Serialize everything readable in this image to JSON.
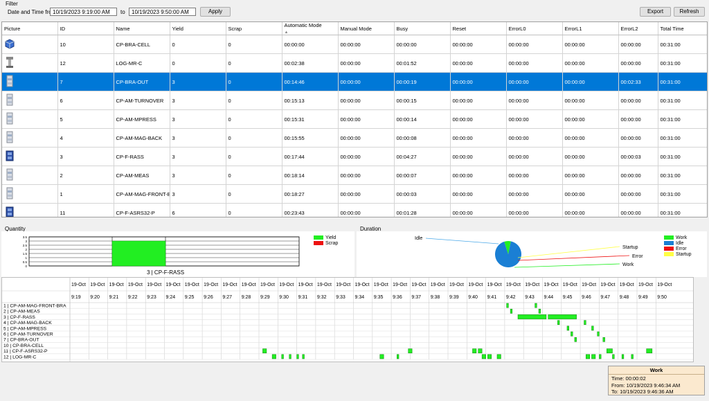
{
  "filter": {
    "title": "Filter",
    "label": "Date and Time from",
    "from": "10/19/2023  9:19:00 AM",
    "to_label": "to",
    "to": "10/19/2023  9:50:00 AM",
    "apply": "Apply",
    "export": "Export",
    "refresh": "Refresh"
  },
  "table": {
    "columns": [
      "Picture",
      "ID",
      "Name",
      "Yield",
      "Scrap",
      "Automatic Mode",
      "Manual Mode",
      "Busy",
      "Reset",
      "ErrorL0",
      "ErrorL1",
      "ErrorL2",
      "Total Time"
    ],
    "rows": [
      {
        "pic": "cube-icon",
        "cells": [
          "10",
          "CP-BRA-CELL",
          "0",
          "0",
          "00:00:00",
          "00:00:00",
          "00:00:00",
          "00:00:00",
          "00:00:00",
          "00:00:00",
          "00:00:00",
          "00:31:00"
        ]
      },
      {
        "pic": "robot-icon",
        "cells": [
          "12",
          "LOG-MR-C",
          "0",
          "0",
          "00:02:38",
          "00:00:00",
          "00:01:52",
          "00:00:00",
          "00:00:00",
          "00:00:00",
          "00:00:00",
          "00:31:00"
        ]
      },
      {
        "pic": "station-icon",
        "cells": [
          "7",
          "CP-BRA-OUT",
          "3",
          "0",
          "00:14:46",
          "00:00:00",
          "00:00:19",
          "00:00:00",
          "00:00:00",
          "00:00:00",
          "00:02:33",
          "00:31:00"
        ]
      },
      {
        "pic": "station-icon",
        "cells": [
          "6",
          "CP-AM-TURNOVER",
          "3",
          "0",
          "00:15:13",
          "00:00:00",
          "00:00:15",
          "00:00:00",
          "00:00:00",
          "00:00:00",
          "00:00:00",
          "00:31:00"
        ]
      },
      {
        "pic": "station-icon",
        "cells": [
          "5",
          "CP-AM-MPRESS",
          "3",
          "0",
          "00:15:31",
          "00:00:00",
          "00:00:14",
          "00:00:00",
          "00:00:00",
          "00:00:00",
          "00:00:00",
          "00:31:00"
        ]
      },
      {
        "pic": "station-icon",
        "cells": [
          "4",
          "CP-AM-MAG-BACK",
          "3",
          "0",
          "00:15:55",
          "00:00:00",
          "00:00:08",
          "00:00:00",
          "00:00:00",
          "00:00:00",
          "00:00:00",
          "00:31:00"
        ]
      },
      {
        "pic": "cabinet-icon",
        "cells": [
          "3",
          "CP-F-RASS",
          "3",
          "0",
          "00:17:44",
          "00:00:00",
          "00:04:27",
          "00:00:00",
          "00:00:00",
          "00:00:00",
          "00:00:03",
          "00:31:00"
        ]
      },
      {
        "pic": "station-icon",
        "cells": [
          "2",
          "CP-AM-MEAS",
          "3",
          "0",
          "00:18:14",
          "00:00:00",
          "00:00:07",
          "00:00:00",
          "00:00:00",
          "00:00:00",
          "00:00:00",
          "00:31:00"
        ]
      },
      {
        "pic": "station-icon",
        "cells": [
          "1",
          "CP-AM-MAG-FRONT-B...",
          "3",
          "0",
          "00:18:27",
          "00:00:00",
          "00:00:03",
          "00:00:00",
          "00:00:00",
          "00:00:00",
          "00:00:00",
          "00:31:00"
        ]
      },
      {
        "pic": "cabinet-icon",
        "cells": [
          "11",
          "CP-F-ASRS32-P",
          "6",
          "0",
          "00:23:43",
          "00:00:00",
          "00:01:28",
          "00:00:00",
          "00:00:00",
          "00:00:00",
          "00:00:00",
          "00:31:00"
        ]
      }
    ]
  },
  "quantity": {
    "title": "Quantity",
    "caption": "3 | CP-F-RASS",
    "chart_data": {
      "type": "bar",
      "categories": [
        "3 | CP-F-RASS"
      ],
      "series": [
        {
          "name": "Yield",
          "values": [
            3
          ]
        },
        {
          "name": "Scrap",
          "values": [
            0
          ]
        }
      ],
      "ylim": [
        0,
        3.5
      ],
      "yticks": [
        "3.5",
        "3",
        "2.5",
        "2",
        "1.5",
        "1",
        "0.5",
        "0"
      ]
    },
    "legend": [
      {
        "name": "Yield",
        "color": "#22ee22"
      },
      {
        "name": "Scrap",
        "color": "#ee1111"
      }
    ]
  },
  "duration": {
    "title": "Duration",
    "chart_data": {
      "type": "pie",
      "slices": [
        {
          "name": "Idle",
          "value": 0.92,
          "color": "#1a7fd4"
        },
        {
          "name": "Work",
          "value": 0.08,
          "color": "#22ee22"
        },
        {
          "name": "Error",
          "value": 0.0,
          "color": "#ee1111"
        },
        {
          "name": "Startup",
          "value": 0.0,
          "color": "#ffff44"
        }
      ]
    },
    "callouts": [
      "Idle",
      "Startup",
      "Error",
      "Work"
    ],
    "legend": [
      {
        "name": "Work",
        "color": "#22ee22"
      },
      {
        "name": "Idle",
        "color": "#1a7fd4"
      },
      {
        "name": "Error",
        "color": "#ee1111"
      },
      {
        "name": "Startup",
        "color": "#ffff44"
      }
    ]
  },
  "gantt": {
    "date": "19-Oct",
    "times": [
      "9:19",
      "9:20",
      "9:21",
      "9:22",
      "9:23",
      "9:24",
      "9:25",
      "9:26",
      "9:27",
      "9:28",
      "9:29",
      "9:30",
      "9:31",
      "9:32",
      "9:33",
      "9:34",
      "9:35",
      "9:36",
      "9:37",
      "9:38",
      "9:39",
      "9:40",
      "9:41",
      "9:42",
      "9:43",
      "9:44",
      "9:45",
      "9:46",
      "9:47",
      "9:48",
      "9:49",
      "9:50"
    ],
    "rows": [
      "1 | CP-AM-MAG-FRONT-BRA",
      "2 | CP-AM-MEAS",
      "3 | CP-F-RASS",
      "4 | CP-AM-MAG-BACK",
      "5 | CP-AM-MPRESS",
      "6 | CP-AM-TURNOVER",
      "7 | CP-BRA-OUT",
      "10 | CP-BRA-CELL",
      "11 | CP-F-ASRS32-P",
      "12 | LOG-MR-C"
    ],
    "segments": [
      [
        0,
        42.1,
        42.2
      ],
      [
        0,
        43.6,
        43.7
      ],
      [
        1,
        42.3,
        42.4
      ],
      [
        1,
        43.8,
        43.9
      ],
      [
        2,
        42.7,
        44.2
      ],
      [
        2,
        44.3,
        45.8
      ],
      [
        3,
        44.8,
        44.9
      ],
      [
        3,
        46.2,
        46.3
      ],
      [
        4,
        45.3,
        45.4
      ],
      [
        4,
        46.6,
        46.7
      ],
      [
        5,
        45.5,
        45.6
      ],
      [
        5,
        46.9,
        47.0
      ],
      [
        6,
        45.7,
        45.8
      ],
      [
        6,
        47.2,
        47.3
      ],
      [
        8,
        29.2,
        29.4
      ],
      [
        8,
        36.9,
        37.1
      ],
      [
        8,
        40.3,
        40.5
      ],
      [
        8,
        40.6,
        40.8
      ],
      [
        8,
        47.4,
        47.7
      ],
      [
        8,
        49.5,
        49.8
      ],
      [
        9,
        29.7,
        29.9
      ],
      [
        9,
        30.2,
        30.3
      ],
      [
        9,
        30.6,
        30.7
      ],
      [
        9,
        31.0,
        31.1
      ],
      [
        9,
        31.3,
        31.4
      ],
      [
        9,
        35.4,
        35.6
      ],
      [
        9,
        36.3,
        36.4
      ],
      [
        9,
        40.8,
        41.0
      ],
      [
        9,
        41.1,
        41.3
      ],
      [
        9,
        41.6,
        41.8
      ],
      [
        9,
        46.3,
        46.5
      ],
      [
        9,
        46.6,
        46.8
      ],
      [
        9,
        47.0,
        47.1
      ],
      [
        9,
        47.7,
        47.8
      ],
      [
        9,
        48.2,
        48.3
      ],
      [
        9,
        48.7,
        48.8
      ]
    ]
  },
  "tooltip": {
    "title": "Work",
    "time": "Time: 00:00:02",
    "from": "From: 10/19/2023 9:46:34 AM",
    "to": "To: 10/19/2023 9:46:36 AM"
  }
}
